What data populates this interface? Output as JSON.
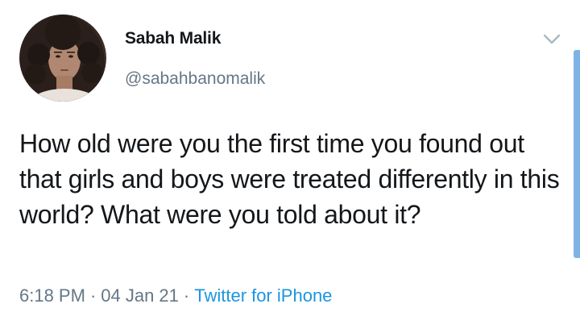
{
  "user": {
    "display_name": "Sabah Malik",
    "handle": "@sabahbanomalik"
  },
  "tweet": {
    "text": "How old were you the first time you found out that girls and boys were treated differently in this world? What were you told about it?",
    "time": "6:18 PM",
    "separator": "·",
    "date": "04 Jan 21",
    "source": "Twitter for iPhone"
  },
  "icons": {
    "avatar": "profile-photo",
    "menu": "chevron-down-icon"
  },
  "colors": {
    "text": "#14171a",
    "secondary": "#657786",
    "link": "#1b95e0",
    "scrollbar": "#7fb3e6"
  }
}
